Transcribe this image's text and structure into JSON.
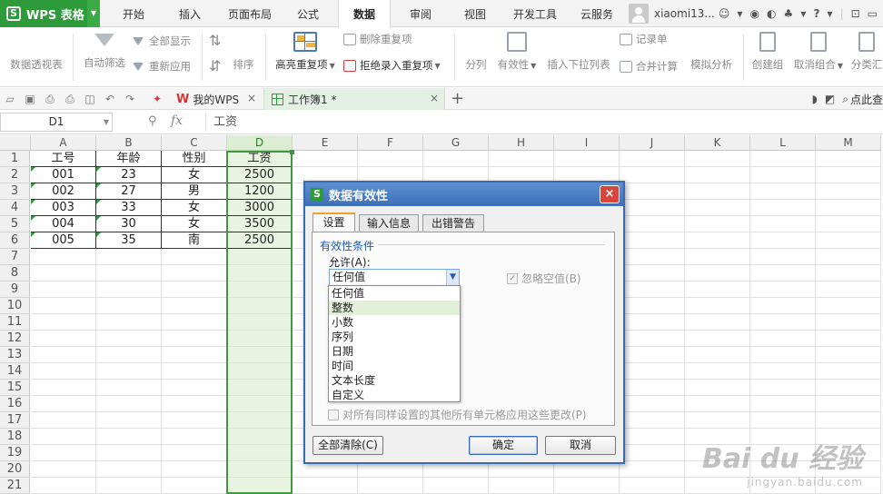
{
  "app": {
    "logo_glyph": "S",
    "name": "WPS 表格",
    "menu_tabs": [
      "开始",
      "插入",
      "页面布局",
      "公式",
      "数据",
      "审阅",
      "视图",
      "开发工具",
      "云服务"
    ],
    "active_tab": "数据",
    "user_name": "xiaomi13...",
    "help_mark": "?"
  },
  "ribbon": {
    "pivot": "数据透视表",
    "auto_filter": "自动筛选",
    "show_all": "全部显示",
    "reapply": "重新应用",
    "sort": "排序",
    "highlight_duplicates": "高亮重复项",
    "remove_duplicates": "删除重复项",
    "reject_duplicates": "拒绝录入重复项",
    "split_column": "分列",
    "validation": "有效性",
    "insert_dropdown": "插入下拉列表",
    "record_form": "记录单",
    "consolidate": "合并计算",
    "what_if": "模拟分析",
    "group": "创建组",
    "ungroup": "取消组合",
    "subtotal": "分类汇"
  },
  "tabs_bar": {
    "doc_tabs": [
      {
        "label": "我的WPS",
        "icon": "wps-logo-icon",
        "close": "×"
      },
      {
        "label": "工作簿1 *",
        "icon": "spreadsheet-icon",
        "close": "×"
      }
    ],
    "new_tab": "+",
    "search_label": "点此查"
  },
  "formula_bar": {
    "name_box": "D1",
    "fx_label": "fx",
    "content": "工资"
  },
  "sheet": {
    "columns": [
      "A",
      "B",
      "C",
      "D",
      "E",
      "F",
      "G",
      "H",
      "I",
      "J",
      "K",
      "L",
      "M"
    ],
    "rows": [
      "1",
      "2",
      "3",
      "4",
      "5",
      "6",
      "7",
      "8",
      "9",
      "10",
      "11",
      "12",
      "13",
      "14",
      "15",
      "16",
      "17",
      "18",
      "19",
      "20",
      "21"
    ],
    "header": [
      "工号",
      "年龄",
      "性别",
      "工资"
    ],
    "data": [
      [
        "001",
        "23",
        "女",
        "2500"
      ],
      [
        "002",
        "27",
        "男",
        "1200"
      ],
      [
        "003",
        "33",
        "女",
        "3000"
      ],
      [
        "004",
        "30",
        "女",
        "3500"
      ],
      [
        "005",
        "35",
        "南",
        "2500"
      ]
    ],
    "selected_column": "D"
  },
  "dialog": {
    "title": "数据有效性",
    "close": "×",
    "tabs": [
      "设置",
      "输入信息",
      "出错警告"
    ],
    "active_tab": "设置",
    "group_title": "有效性条件",
    "allow_label": "允许(A):",
    "allow_value": "任何值",
    "ignore_blank": "忽略空值(B)",
    "ignore_blank_checked": true,
    "allow_options": [
      "任何值",
      "整数",
      "小数",
      "序列",
      "日期",
      "时间",
      "文本长度",
      "自定义"
    ],
    "hover_option": "整数",
    "apply_all": "对所有同样设置的其他所有单元格应用这些更改(P)",
    "clear_all": "全部清除(C)",
    "ok": "确定",
    "cancel": "取消"
  },
  "watermark": {
    "main": "Bai du 经验",
    "sub": "jingyan.baidu.com"
  }
}
